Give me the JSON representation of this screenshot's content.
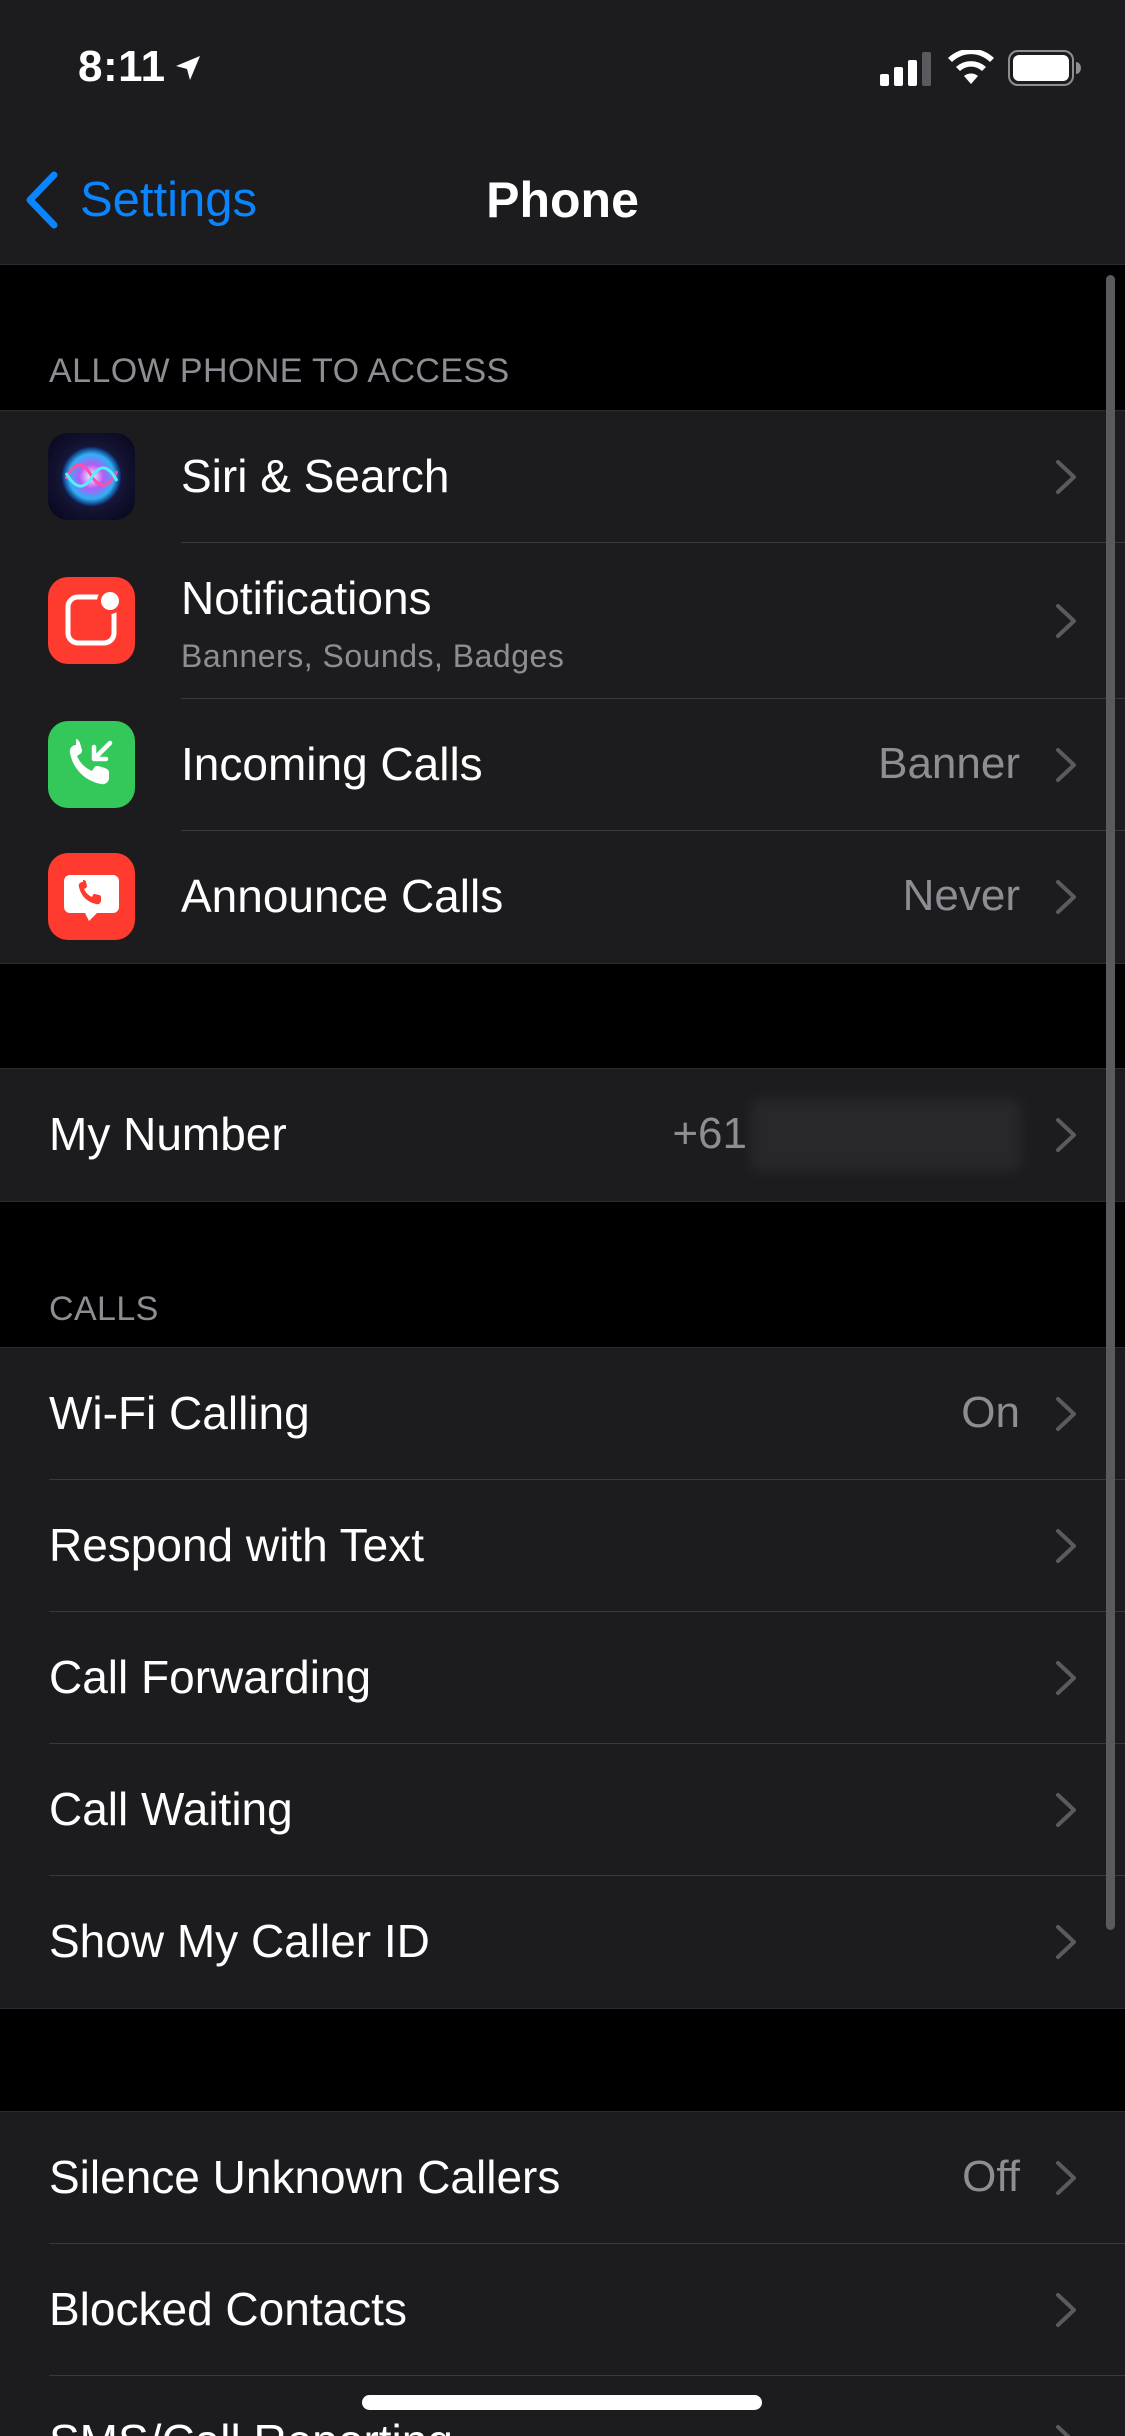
{
  "status_bar": {
    "time": "8:11"
  },
  "nav": {
    "back_label": "Settings",
    "title": "Phone"
  },
  "section_allow": {
    "header": "ALLOW PHONE TO ACCESS",
    "rows": [
      {
        "label": "Siri & Search",
        "icon": "siri-icon"
      },
      {
        "label": "Notifications",
        "subtitle": "Banners, Sounds, Badges",
        "icon": "notifications-icon",
        "icon_color": "#ff3b30"
      },
      {
        "label": "Incoming Calls",
        "value": "Banner",
        "icon": "incoming-calls-icon",
        "icon_color": "#34c759"
      },
      {
        "label": "Announce Calls",
        "value": "Never",
        "icon": "announce-calls-icon",
        "icon_color": "#ff3b30"
      }
    ]
  },
  "my_number": {
    "label": "My Number",
    "value": "+61"
  },
  "section_calls": {
    "header": "CALLS",
    "rows": [
      {
        "label": "Wi-Fi Calling",
        "value": "On"
      },
      {
        "label": "Respond with Text"
      },
      {
        "label": "Call Forwarding"
      },
      {
        "label": "Call Waiting"
      },
      {
        "label": "Show My Caller ID"
      }
    ]
  },
  "section_more": {
    "rows": [
      {
        "label": "Silence Unknown Callers",
        "value": "Off"
      },
      {
        "label": "Blocked Contacts"
      },
      {
        "label": "SMS/Call Reporting"
      }
    ]
  },
  "colors": {
    "accent": "#0a84ff",
    "background": "#000000",
    "cell": "#1c1c1e",
    "secondary_text": "#8d8d93"
  }
}
